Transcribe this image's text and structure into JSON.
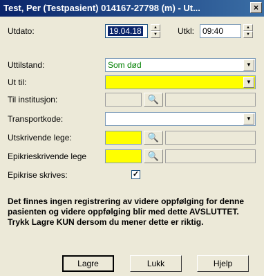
{
  "window": {
    "title": "Test, Per (Testpasient)  014167-27798 (m) - Ut...",
    "close": "×"
  },
  "form": {
    "utdato": {
      "label": "Utdato:",
      "value": "19.04.18"
    },
    "utkl": {
      "label": "Utkl:",
      "value": "09:40"
    },
    "uttilstand": {
      "label": "Uttilstand:",
      "value": "Som død"
    },
    "uttil": {
      "label": "Ut til:",
      "value": ""
    },
    "til_institusjon": {
      "label": "Til institusjon:",
      "value": ""
    },
    "transportkode": {
      "label": "Transportkode:",
      "value": ""
    },
    "utskrivende_lege": {
      "label": "Utskrivende lege:",
      "value": ""
    },
    "epikriseskrivende_lege": {
      "label": "Epikrieskrivende lege",
      "value": ""
    },
    "epikrise_skrives": {
      "label": "Epikrise skrives:",
      "checked": true,
      "mark": "✓"
    }
  },
  "message": "Det finnes ingen registrering av videre oppfølging for denne pasienten og videre oppfølging blir med dette AVSLUTTET.  Trykk Lagre KUN dersom du mener dette er riktig.",
  "buttons": {
    "lagre": "Lagre",
    "lukk": "Lukk",
    "hjelp": "Hjelp"
  },
  "icons": {
    "binoculars": "🔍",
    "spin_up": "▲",
    "spin_down": "▼",
    "dropdown": "▼"
  }
}
